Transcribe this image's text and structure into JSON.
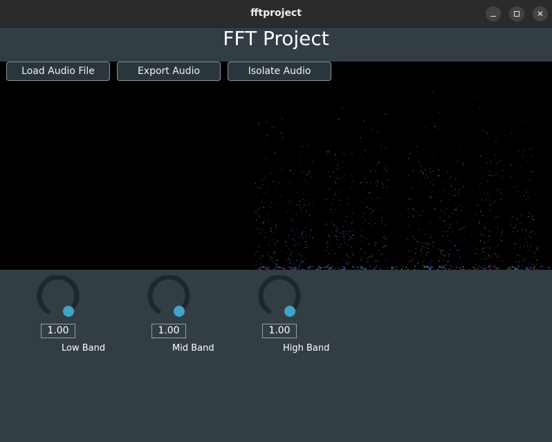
{
  "window": {
    "title": "fftproject",
    "minimize_icon": "minimize-icon",
    "maximize_icon": "maximize-icon",
    "close_symbol": "✕"
  },
  "app": {
    "heading": "FFT Project"
  },
  "toolbar": {
    "load_label": "Load Audio File",
    "export_label": "Export Audio",
    "isolate_label": "Isolate Audio"
  },
  "knobs": [
    {
      "value": "1.00",
      "label": "Low Band"
    },
    {
      "value": "1.00",
      "label": "Mid Band"
    },
    {
      "value": "1.00",
      "label": "High Band"
    }
  ],
  "colors": {
    "background": "#323e44",
    "knob_track": "#1e272b",
    "knob_thumb": "#42a2c8",
    "spectrogram_bg": "#000000"
  }
}
